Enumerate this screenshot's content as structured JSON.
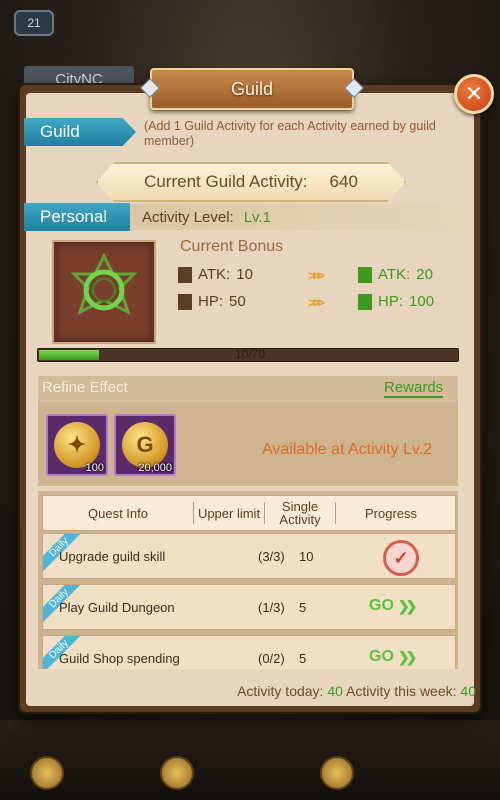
{
  "background": {
    "badge": "21",
    "city_label": "CityNC"
  },
  "title": "Guild",
  "close_symbol": "✕",
  "guild_section": {
    "tab": "Guild",
    "note": "(Add 1 Guild Activity for each Activity earned by guild member)",
    "activity_label": "Current Guild Activity:",
    "activity_value": "640"
  },
  "personal_section": {
    "tab": "Personal",
    "level_label": "Activity Level:",
    "level_value": "Lv.1",
    "bonus_title": "Current Bonus",
    "current": {
      "atk_label": "ATK:",
      "atk": "10",
      "hp_label": "HP:",
      "hp": "50"
    },
    "next": {
      "atk_label": "ATK:",
      "atk": "20",
      "hp_label": "HP:",
      "hp": "100"
    },
    "progress": {
      "current": 10,
      "max": 70,
      "text": "10/70"
    }
  },
  "refine": {
    "title": "Refine Effect",
    "rewards_link": "Rewards",
    "items": [
      {
        "icon": "guild-coin-icon",
        "qty": "100"
      },
      {
        "icon": "gold-coin-icon",
        "symbol": "G",
        "qty": "20,000"
      }
    ],
    "available_text": "Available at Activity Lv.2"
  },
  "quests": {
    "headers": {
      "info": "Quest Info",
      "limit": "Upper limit",
      "single": "Single Activity",
      "progress": "Progress"
    },
    "rows": [
      {
        "tag": "Daily",
        "name": "Upgrade guild skill",
        "limit": "(3/3)",
        "single": "10",
        "status": "done"
      },
      {
        "tag": "Daily",
        "name": "Play Guild Dungeon",
        "limit": "(1/3)",
        "single": "5",
        "status": "go",
        "go_label": "GO"
      },
      {
        "tag": "Daily",
        "name": "Guild Shop spending",
        "limit": "(0/2)",
        "single": "5",
        "status": "go",
        "go_label": "GO"
      }
    ]
  },
  "footer": {
    "today_label": "Activity today:",
    "today_value": "40",
    "week_label": "Activity this week:",
    "week_value": "40"
  },
  "colors": {
    "accent_green": "#3d9a1e",
    "tab_blue": "#1f7f9e",
    "orange": "#e06a26"
  }
}
